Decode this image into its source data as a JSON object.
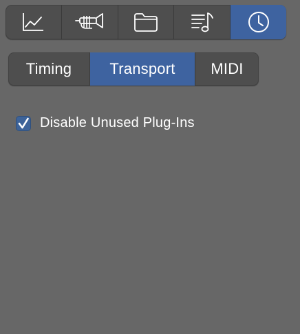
{
  "colors": {
    "accent": "#3e63a0",
    "background": "#676767",
    "control": "#4e4e4e"
  },
  "toolbar": {
    "buttons": [
      {
        "icon": "line-chart-icon",
        "active": false
      },
      {
        "icon": "trumpet-icon",
        "active": false
      },
      {
        "icon": "folder-icon",
        "active": false
      },
      {
        "icon": "music-score-icon",
        "active": false
      },
      {
        "icon": "clock-icon",
        "active": true
      }
    ]
  },
  "tabs": [
    {
      "label": "Timing",
      "active": false
    },
    {
      "label": "Transport",
      "active": true
    },
    {
      "label": "MIDI",
      "active": false
    }
  ],
  "options": {
    "disable_unused_plugins": {
      "label": "Disable Unused Plug-Ins",
      "checked": true
    }
  }
}
